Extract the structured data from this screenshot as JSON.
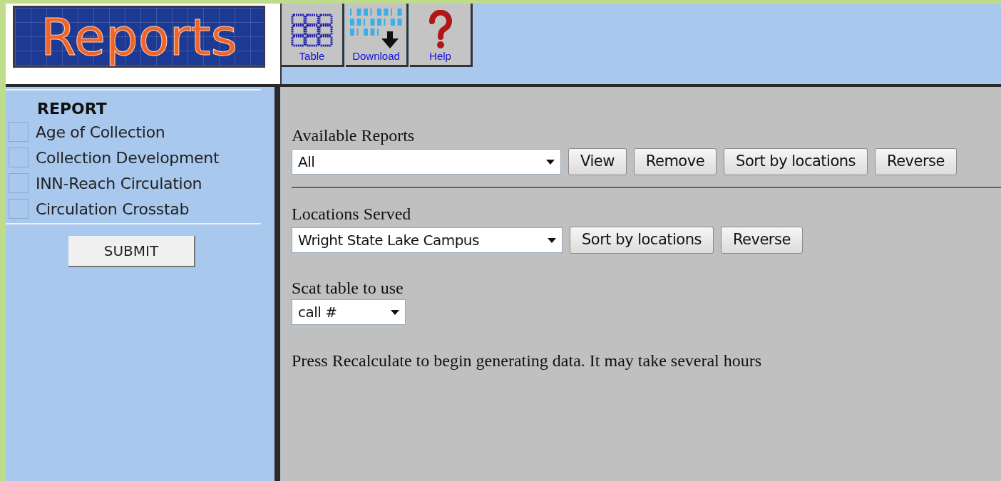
{
  "logo": {
    "text": "Reports"
  },
  "toolbar": [
    {
      "kind": "table",
      "label": "Table"
    },
    {
      "kind": "download",
      "label": "Download"
    },
    {
      "kind": "help",
      "label": "Help"
    }
  ],
  "sidebar": {
    "heading": "REPORT",
    "items": [
      {
        "label": "Age of Collection",
        "checked": false
      },
      {
        "label": "Collection Development",
        "checked": false
      },
      {
        "label": "INN-Reach Circulation",
        "checked": false
      },
      {
        "label": "Circulation Crosstab",
        "checked": false
      }
    ],
    "submit": "SUBMIT"
  },
  "available_reports": {
    "label": "Available Reports",
    "value": "All",
    "buttons": [
      "View",
      "Remove",
      "Sort by locations",
      "Reverse"
    ]
  },
  "locations_served": {
    "label": "Locations Served",
    "value": "Wright State Lake Campus",
    "buttons": [
      "Sort by locations",
      "Reverse"
    ]
  },
  "scat_table": {
    "label": "Scat table to use",
    "value": "call #"
  },
  "message": "Press Recalculate to begin generating data. It may take several hours"
}
